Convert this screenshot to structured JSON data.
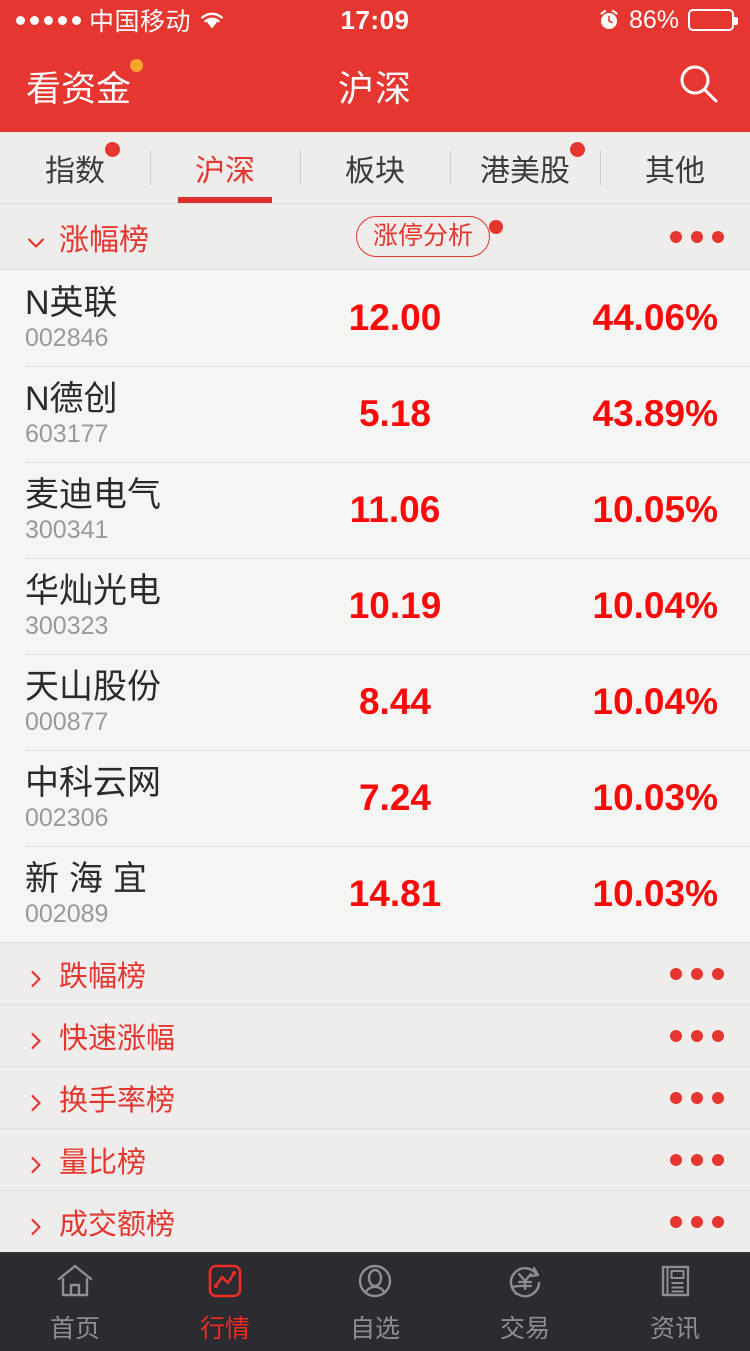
{
  "status_bar": {
    "signal_dots": 5,
    "carrier": "中国移动",
    "wifi_icon": "wifi-icon",
    "time": "17:09",
    "alarm_icon": "alarm-icon",
    "battery_percent": "86%",
    "battery_level": 86
  },
  "nav": {
    "left_label": "看资金",
    "left_badge_color": "#f7a52b",
    "title": "沪深",
    "search_icon": "search-icon"
  },
  "tabs": [
    {
      "label": "指数",
      "active": false,
      "badge": true
    },
    {
      "label": "沪深",
      "active": true,
      "badge": false
    },
    {
      "label": "板块",
      "active": false,
      "badge": false
    },
    {
      "label": "港美股",
      "active": false,
      "badge": true
    },
    {
      "label": "其他",
      "active": false,
      "badge": false
    }
  ],
  "expanded_section": {
    "title": "涨幅榜",
    "chevron": "chevron-down-icon",
    "pill_label": "涨停分析",
    "pill_badge": true,
    "more_label": "•••"
  },
  "stocks": [
    {
      "name": "N英联",
      "code": "002846",
      "price": "12.00",
      "change": "44.06%",
      "spaced": false
    },
    {
      "name": "N德创",
      "code": "603177",
      "price": "5.18",
      "change": "43.89%",
      "spaced": false
    },
    {
      "name": "麦迪电气",
      "code": "300341",
      "price": "11.06",
      "change": "10.05%",
      "spaced": false
    },
    {
      "name": "华灿光电",
      "code": "300323",
      "price": "10.19",
      "change": "10.04%",
      "spaced": false
    },
    {
      "name": "天山股份",
      "code": "000877",
      "price": "8.44",
      "change": "10.04%",
      "spaced": false
    },
    {
      "name": "中科云网",
      "code": "002306",
      "price": "7.24",
      "change": "10.03%",
      "spaced": false
    },
    {
      "name": "新海宜",
      "code": "002089",
      "price": "14.81",
      "change": "10.03%",
      "spaced": true
    }
  ],
  "collapsed_sections": [
    {
      "title": "跌幅榜",
      "chevron": "chevron-right-icon"
    },
    {
      "title": "快速涨幅",
      "chevron": "chevron-right-icon"
    },
    {
      "title": "换手率榜",
      "chevron": "chevron-right-icon"
    },
    {
      "title": "量比榜",
      "chevron": "chevron-right-icon"
    },
    {
      "title": "成交额榜",
      "chevron": "chevron-right-icon"
    }
  ],
  "bottom_nav": [
    {
      "label": "首页",
      "icon": "home-icon",
      "active": false
    },
    {
      "label": "行情",
      "icon": "chart-icon",
      "active": true
    },
    {
      "label": "自选",
      "icon": "person-icon",
      "active": false
    },
    {
      "label": "交易",
      "icon": "yen-trade-icon",
      "active": false
    },
    {
      "label": "资讯",
      "icon": "news-icon",
      "active": false
    }
  ],
  "colors": {
    "brand_red": "#e5362f",
    "quote_red": "#fa0a0a",
    "badge_orange": "#f7a52b",
    "bottom_nav_bg": "#2b2b30"
  }
}
